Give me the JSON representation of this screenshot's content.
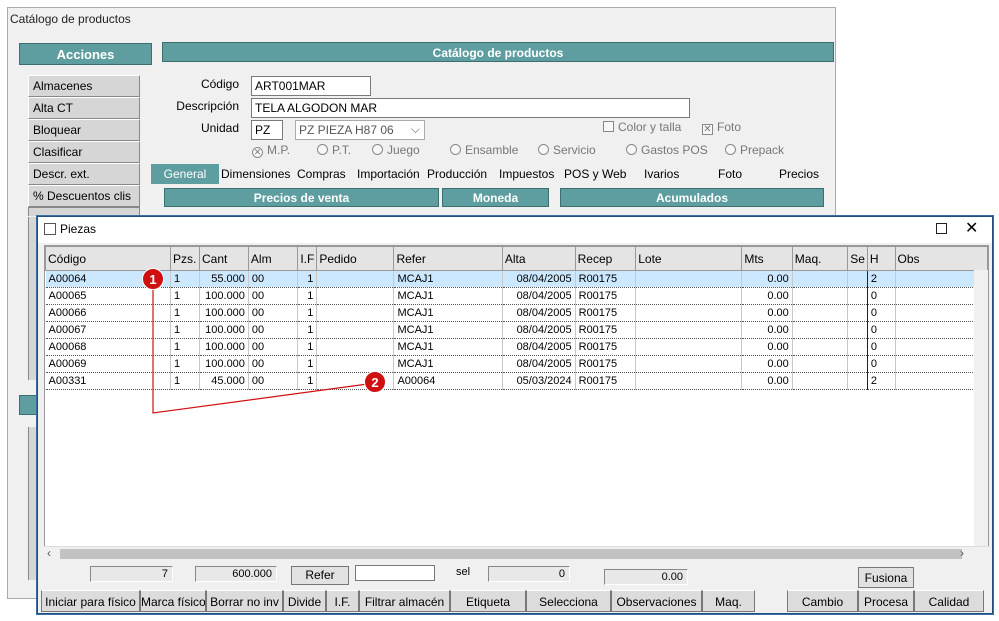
{
  "bg": {
    "title": "Catálogo de productos",
    "acciones_header": "Acciones",
    "header": "Catálogo de productos",
    "acciones": [
      "Almacenes",
      "Alta CT",
      "Bloquear",
      "Clasificar",
      "Descr. ext.",
      "% Descuentos clis"
    ],
    "labels": {
      "codigo": "Código",
      "descripcion": "Descripción",
      "unidad": "Unidad"
    },
    "values": {
      "codigo": "ART001MAR",
      "descripcion": "TELA ALGODON MAR",
      "unidad": "PZ",
      "unidad_desc": "PZ  PIEZA H87 06"
    },
    "checks": {
      "color_talla": "Color y talla",
      "foto": "Foto"
    },
    "options": [
      "M.P.",
      "P.T.",
      "Juego",
      "Ensamble",
      "Servicio",
      "Gastos POS",
      "Prepack"
    ],
    "tabs": [
      "General",
      "Dimensiones",
      "Compras",
      "Importación",
      "Producción",
      "Impuestos",
      "POS y Web",
      "Ivarios",
      "Foto",
      "Precios"
    ],
    "sections": [
      "Precios de venta",
      "Moneda",
      "Acumulados"
    ]
  },
  "dialog": {
    "title": "Piezas",
    "columns": [
      "Código",
      "Pzs.",
      "Cant",
      "Alm",
      "I.F",
      "Pedido",
      "Refer",
      "Alta",
      "Recep",
      "Lote",
      "Mts",
      "Maq.",
      "Se",
      "H",
      "Obs"
    ],
    "rows": [
      {
        "codigo": "A00064",
        "pzs": "1",
        "cant": "55.000",
        "alm": "00",
        "if": "1",
        "pedido": "",
        "refer": "MCAJ1",
        "alta": "08/04/2005",
        "recep": "R00175",
        "lote": "",
        "mts": "0.00",
        "maq": "",
        "se": "",
        "h": "2",
        "obs": ""
      },
      {
        "codigo": "A00065",
        "pzs": "1",
        "cant": "100.000",
        "alm": "00",
        "if": "1",
        "pedido": "",
        "refer": "MCAJ1",
        "alta": "08/04/2005",
        "recep": "R00175",
        "lote": "",
        "mts": "0.00",
        "maq": "",
        "se": "",
        "h": "0",
        "obs": ""
      },
      {
        "codigo": "A00066",
        "pzs": "1",
        "cant": "100.000",
        "alm": "00",
        "if": "1",
        "pedido": "",
        "refer": "MCAJ1",
        "alta": "08/04/2005",
        "recep": "R00175",
        "lote": "",
        "mts": "0.00",
        "maq": "",
        "se": "",
        "h": "0",
        "obs": ""
      },
      {
        "codigo": "A00067",
        "pzs": "1",
        "cant": "100.000",
        "alm": "00",
        "if": "1",
        "pedido": "",
        "refer": "MCAJ1",
        "alta": "08/04/2005",
        "recep": "R00175",
        "lote": "",
        "mts": "0.00",
        "maq": "",
        "se": "",
        "h": "0",
        "obs": ""
      },
      {
        "codigo": "A00068",
        "pzs": "1",
        "cant": "100.000",
        "alm": "00",
        "if": "1",
        "pedido": "",
        "refer": "MCAJ1",
        "alta": "08/04/2005",
        "recep": "R00175",
        "lote": "",
        "mts": "0.00",
        "maq": "",
        "se": "",
        "h": "0",
        "obs": ""
      },
      {
        "codigo": "A00069",
        "pzs": "1",
        "cant": "100.000",
        "alm": "00",
        "if": "1",
        "pedido": "",
        "refer": "MCAJ1",
        "alta": "08/04/2005",
        "recep": "R00175",
        "lote": "",
        "mts": "0.00",
        "maq": "",
        "se": "",
        "h": "0",
        "obs": ""
      },
      {
        "codigo": "A00331",
        "pzs": "1",
        "cant": "45.000",
        "alm": "00",
        "if": "1",
        "pedido": "",
        "refer": "A00064",
        "alta": "05/03/2024",
        "recep": "R00175",
        "lote": "",
        "mts": "0.00",
        "maq": "",
        "se": "",
        "h": "2",
        "obs": ""
      }
    ],
    "totals": {
      "pzs": "7",
      "cant": "600.000",
      "refer_button": "Refer",
      "sel_label": "sel",
      "sel_count": "0",
      "mts": "0.00"
    },
    "fusiona": "Fusiona",
    "buttons": [
      "Iniciar para físico",
      "Marca físico",
      "Borrar no inv",
      "Divide",
      "I.F.",
      "Filtrar almacén",
      "Etiqueta",
      "Selecciona",
      "Observaciones",
      "Maq.",
      "Cambio",
      "Procesa",
      "Calidad"
    ],
    "callouts": [
      "1",
      "2"
    ]
  }
}
